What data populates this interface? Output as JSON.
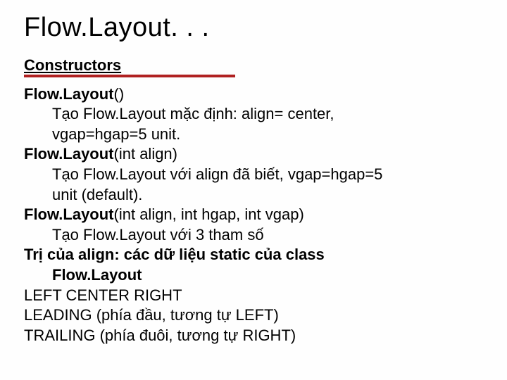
{
  "title": "Flow.Layout. . .",
  "sectionHeader": "Constructors",
  "ctor1": {
    "name": "Flow.Layout",
    "args": "()"
  },
  "desc1a": "Tạo Flow.Layout mặc định: align= center,",
  "desc1b": "vgap=hgap=5 unit.",
  "ctor2": {
    "name": "Flow.Layout",
    "args": "(int align)"
  },
  "desc2a": "Tạo Flow.Layout với align đã biết, vgap=hgap=5",
  "desc2b": "unit (default).",
  "ctor3": {
    "name": "Flow.Layout",
    "args": "(int align, int hgap, int vgap)"
  },
  "desc3": "Tạo Flow.Layout với 3 tham số",
  "alignHeader1": "Trị của align: các dữ liệu static của class",
  "alignHeader2": "Flow.Layout",
  "constants1": "LEFT  CENTER   RIGHT",
  "constants2": "LEADING (phía đầu, tương tự LEFT)",
  "constants3": "TRAILING (phía đuôi, tương tự RIGHT)"
}
